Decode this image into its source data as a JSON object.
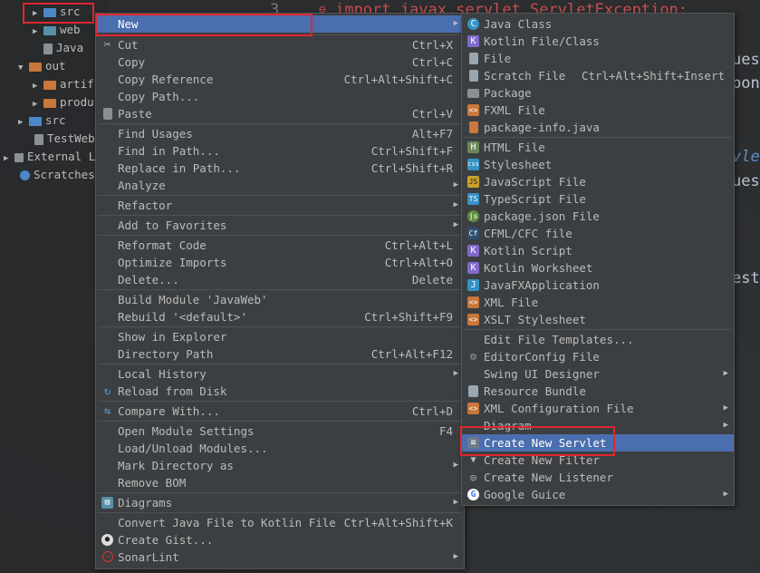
{
  "project_tree": [
    {
      "label": "src",
      "icon": "blue-folder-icon",
      "arrow": "▶"
    },
    {
      "label": "web",
      "icon": "web-folder-icon",
      "arrow": "▶"
    },
    {
      "label": "Java",
      "icon": "module-file-icon",
      "arrow": ""
    },
    {
      "label": "out",
      "icon": "orange-folder-icon",
      "arrow": "▼"
    },
    {
      "label": "artif",
      "icon": "orange-folder-icon",
      "arrow": "▶"
    },
    {
      "label": "produ",
      "icon": "orange-folder-icon",
      "arrow": "▶"
    },
    {
      "label": "src",
      "icon": "blue-folder-icon",
      "arrow": "▶"
    },
    {
      "label": "TestWeb",
      "icon": "file-icon",
      "arrow": ""
    },
    {
      "label": "External L",
      "icon": "library-icon",
      "arrow": "▶"
    },
    {
      "label": "Scratches",
      "icon": "scratches-icon",
      "arrow": ""
    }
  ],
  "editor": {
    "line_number": "3",
    "import_kw": "import",
    "import_pkg": "javax.servlet.ServletException;",
    "fragments": [
      "uest",
      "ponse",
      "vle",
      "ues",
      "est"
    ]
  },
  "context_menu": {
    "items": [
      {
        "label": "New",
        "shortcut": "",
        "arrow": true,
        "icon": ""
      },
      {
        "label": "Cut",
        "shortcut": "Ctrl+X",
        "icon": "scissors-icon"
      },
      {
        "label": "Copy",
        "shortcut": "Ctrl+C",
        "icon": ""
      },
      {
        "label": "Copy Reference",
        "shortcut": "Ctrl+Alt+Shift+C",
        "icon": ""
      },
      {
        "label": "Copy Path...",
        "shortcut": "",
        "icon": ""
      },
      {
        "label": "Paste",
        "shortcut": "Ctrl+V",
        "icon": "clipboard-icon"
      },
      {
        "label": "Find Usages",
        "shortcut": "Alt+F7",
        "icon": ""
      },
      {
        "label": "Find in Path...",
        "shortcut": "Ctrl+Shift+F",
        "icon": ""
      },
      {
        "label": "Replace in Path...",
        "shortcut": "Ctrl+Shift+R",
        "icon": ""
      },
      {
        "label": "Analyze",
        "shortcut": "",
        "arrow": true,
        "icon": ""
      },
      {
        "label": "Refactor",
        "shortcut": "",
        "arrow": true,
        "icon": ""
      },
      {
        "label": "Add to Favorites",
        "shortcut": "",
        "arrow": true,
        "icon": ""
      },
      {
        "label": "Reformat Code",
        "shortcut": "Ctrl+Alt+L",
        "icon": ""
      },
      {
        "label": "Optimize Imports",
        "shortcut": "Ctrl+Alt+O",
        "icon": ""
      },
      {
        "label": "Delete...",
        "shortcut": "Delete",
        "icon": ""
      },
      {
        "label": "Build Module 'JavaWeb'",
        "shortcut": "",
        "icon": ""
      },
      {
        "label": "Rebuild '<default>'",
        "shortcut": "Ctrl+Shift+F9",
        "icon": ""
      },
      {
        "label": "Show in Explorer",
        "shortcut": "",
        "icon": ""
      },
      {
        "label": "Directory Path",
        "shortcut": "Ctrl+Alt+F12",
        "icon": ""
      },
      {
        "label": "Local History",
        "shortcut": "",
        "arrow": true,
        "icon": ""
      },
      {
        "label": "Reload from Disk",
        "shortcut": "",
        "icon": "reload-icon"
      },
      {
        "label": "Compare With...",
        "shortcut": "Ctrl+D",
        "icon": "compare-icon"
      },
      {
        "label": "Open Module Settings",
        "shortcut": "F4",
        "icon": ""
      },
      {
        "label": "Load/Unload Modules...",
        "shortcut": "",
        "icon": ""
      },
      {
        "label": "Mark Directory as",
        "shortcut": "",
        "arrow": true,
        "icon": ""
      },
      {
        "label": "Remove BOM",
        "shortcut": "",
        "icon": ""
      },
      {
        "label": "Diagrams",
        "shortcut": "",
        "arrow": true,
        "icon": "diagram-icon"
      },
      {
        "label": "Convert Java File to Kotlin File",
        "shortcut": "Ctrl+Alt+Shift+K",
        "icon": ""
      },
      {
        "label": "Create Gist...",
        "shortcut": "",
        "icon": "github-icon"
      },
      {
        "label": "SonarLint",
        "shortcut": "",
        "arrow": true,
        "icon": "sonarlint-icon"
      }
    ]
  },
  "new_submenu": {
    "items": [
      {
        "label": "Java Class",
        "shortcut": "",
        "icon_text": "C",
        "icon_color": "#3592c4"
      },
      {
        "label": "Kotlin File/Class",
        "shortcut": "",
        "icon_text": "K",
        "icon_color": "#7f6ac9"
      },
      {
        "label": "File",
        "shortcut": "",
        "icon_text": "",
        "icon_color": "#9aa7b0"
      },
      {
        "label": "Scratch File",
        "shortcut": "Ctrl+Alt+Shift+Insert",
        "icon_text": "",
        "icon_color": "#9aa7b0"
      },
      {
        "label": "Package",
        "shortcut": "",
        "icon_text": "",
        "icon_color": "#8a8f94"
      },
      {
        "label": "FXML File",
        "shortcut": "",
        "icon_text": "<>",
        "icon_color": "#c9773a"
      },
      {
        "label": "package-info.java",
        "shortcut": "",
        "icon_text": "",
        "icon_color": "#c9773a"
      },
      {
        "label": "HTML File",
        "shortcut": "",
        "icon_text": "H",
        "icon_color": "#6a8759"
      },
      {
        "label": "Stylesheet",
        "shortcut": "",
        "icon_text": "css",
        "icon_color": "#3592c4"
      },
      {
        "label": "JavaScript File",
        "shortcut": "",
        "icon_text": "JS",
        "icon_color": "#c9a227"
      },
      {
        "label": "TypeScript File",
        "shortcut": "",
        "icon_text": "TS",
        "icon_color": "#3592c4"
      },
      {
        "label": "package.json File",
        "shortcut": "",
        "icon_text": "js",
        "icon_color": "#5f8f3f"
      },
      {
        "label": "CFML/CFC file",
        "shortcut": "",
        "icon_text": "Cf",
        "icon_color": "#2f4f6f"
      },
      {
        "label": "Kotlin Script",
        "shortcut": "",
        "icon_text": "K",
        "icon_color": "#7f6ac9"
      },
      {
        "label": "Kotlin Worksheet",
        "shortcut": "",
        "icon_text": "K",
        "icon_color": "#7f6ac9"
      },
      {
        "label": "JavaFXApplication",
        "shortcut": "",
        "icon_text": "J",
        "icon_color": "#3592c4"
      },
      {
        "label": "XML File",
        "shortcut": "",
        "icon_text": "<>",
        "icon_color": "#c9773a"
      },
      {
        "label": "XSLT Stylesheet",
        "shortcut": "",
        "icon_text": "<>",
        "icon_color": "#c9773a"
      },
      {
        "label": "Edit File Templates...",
        "shortcut": "",
        "icon_text": "",
        "icon_color": ""
      },
      {
        "label": "EditorConfig File",
        "shortcut": "",
        "icon_text": "⚙",
        "icon_color": "#7a7a7a"
      },
      {
        "label": "Swing UI Designer",
        "shortcut": "",
        "arrow": true,
        "icon_text": "",
        "icon_color": ""
      },
      {
        "label": "Resource Bundle",
        "shortcut": "",
        "icon_text": "",
        "icon_color": "#9aa7b0"
      },
      {
        "label": "XML Configuration File",
        "shortcut": "",
        "arrow": true,
        "icon_text": "<>",
        "icon_color": "#c9773a"
      },
      {
        "label": "Diagram",
        "shortcut": "",
        "arrow": true,
        "icon_text": "",
        "icon_color": ""
      },
      {
        "label": "Create New Servlet",
        "shortcut": "",
        "icon_text": "≡",
        "icon_color": "#6d7b8a",
        "selected": true
      },
      {
        "label": "Create New Filter",
        "shortcut": "",
        "icon_text": "▼",
        "icon_color": "#6d7b8a"
      },
      {
        "label": "Create New Listener",
        "shortcut": "",
        "icon_text": "◎",
        "icon_color": "#6d7b8a"
      },
      {
        "label": "Google Guice",
        "shortcut": "",
        "arrow": true,
        "icon_text": "G",
        "icon_color": "#4285f4"
      }
    ]
  },
  "colors": {
    "menu_bg": "#3c3f41",
    "selection": "#4b6eaf",
    "highlight_box": "#e0262f"
  }
}
